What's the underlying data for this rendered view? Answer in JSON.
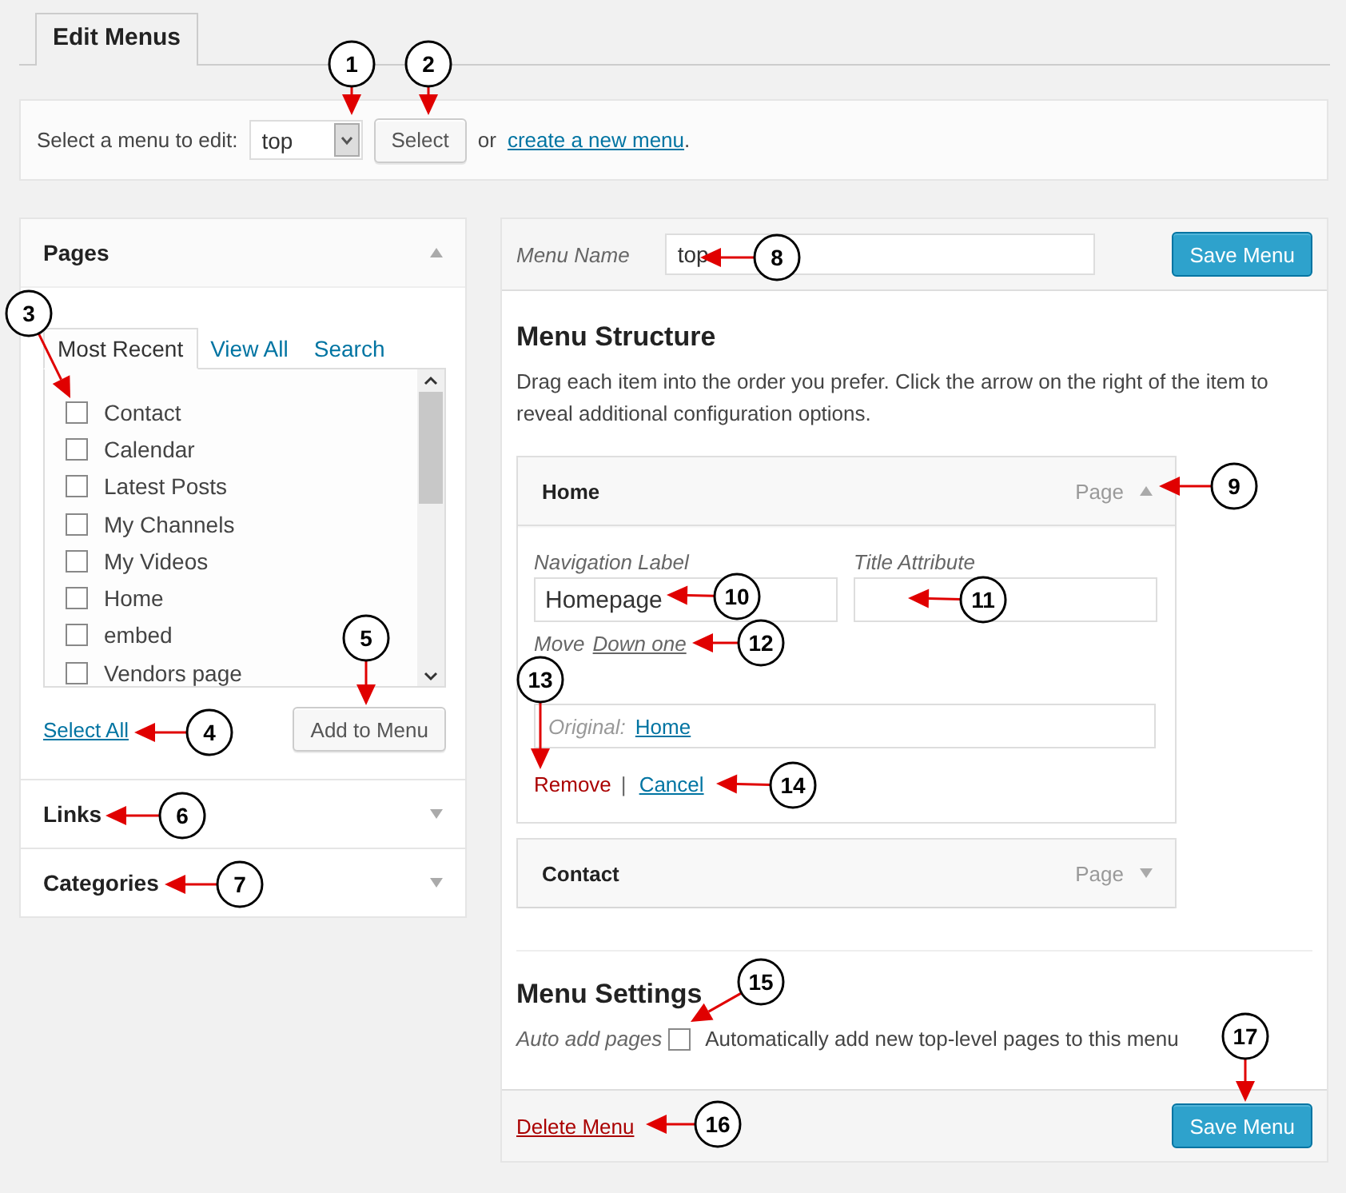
{
  "tab": {
    "label": "Edit Menus",
    "selected": true
  },
  "menu_select": {
    "label": "Select a menu to edit:",
    "value": "top",
    "button": "Select",
    "or_text": "or",
    "link": "create a new menu",
    "period": "."
  },
  "pages_box": {
    "title": "Pages",
    "expanded": true,
    "tabs": [
      {
        "label": "Most Recent",
        "selected": true
      },
      {
        "label": "View All",
        "selected": false
      },
      {
        "label": "Search",
        "selected": false
      }
    ],
    "items": [
      {
        "label": "Contact",
        "checked": false
      },
      {
        "label": "Calendar",
        "checked": false
      },
      {
        "label": "Latest Posts",
        "checked": false
      },
      {
        "label": "My Channels",
        "checked": false
      },
      {
        "label": "My Videos",
        "checked": false
      },
      {
        "label": "Home",
        "checked": false
      },
      {
        "label": "embed",
        "checked": false
      },
      {
        "label": "Vendors page",
        "checked": false
      }
    ],
    "select_all": "Select All",
    "add_button": "Add to Menu"
  },
  "collapsed_boxes": [
    {
      "title": "Links",
      "expanded": false
    },
    {
      "title": "Categories",
      "expanded": false
    }
  ],
  "menu_editor": {
    "name_label": "Menu Name",
    "name_value": "top",
    "save_button": "Save Menu",
    "structure_title": "Menu Structure",
    "structure_hint": "Drag each item into the order you prefer. Click the arrow on the right of the item to reveal additional configuration options.",
    "items": [
      {
        "title": "Home",
        "type": "Page",
        "expanded": true,
        "nav_label_caption": "Navigation Label",
        "nav_label_value": "Homepage",
        "title_attr_caption": "Title Attribute",
        "move_label": "Move",
        "move_link": "Down one",
        "original_label": "Original:",
        "original_link": "Home",
        "remove": "Remove",
        "separator": "|",
        "cancel": "Cancel"
      },
      {
        "title": "Contact",
        "type": "Page",
        "expanded": false
      }
    ],
    "settings_title": "Menu Settings",
    "auto_add_caption": "Auto add pages",
    "auto_add_label": "Automatically add new top-level pages to this menu",
    "auto_add_checked": false,
    "delete_link": "Delete Menu",
    "footer_save_button": "Save Menu"
  },
  "callouts": [
    {
      "number": "1"
    },
    {
      "number": "2"
    },
    {
      "number": "3"
    },
    {
      "number": "4"
    },
    {
      "number": "5"
    },
    {
      "number": "6"
    },
    {
      "number": "7"
    },
    {
      "number": "8"
    },
    {
      "number": "9"
    },
    {
      "number": "10"
    },
    {
      "number": "11"
    },
    {
      "number": "12"
    },
    {
      "number": "13"
    },
    {
      "number": "14"
    },
    {
      "number": "15"
    },
    {
      "number": "16"
    },
    {
      "number": "17"
    }
  ]
}
